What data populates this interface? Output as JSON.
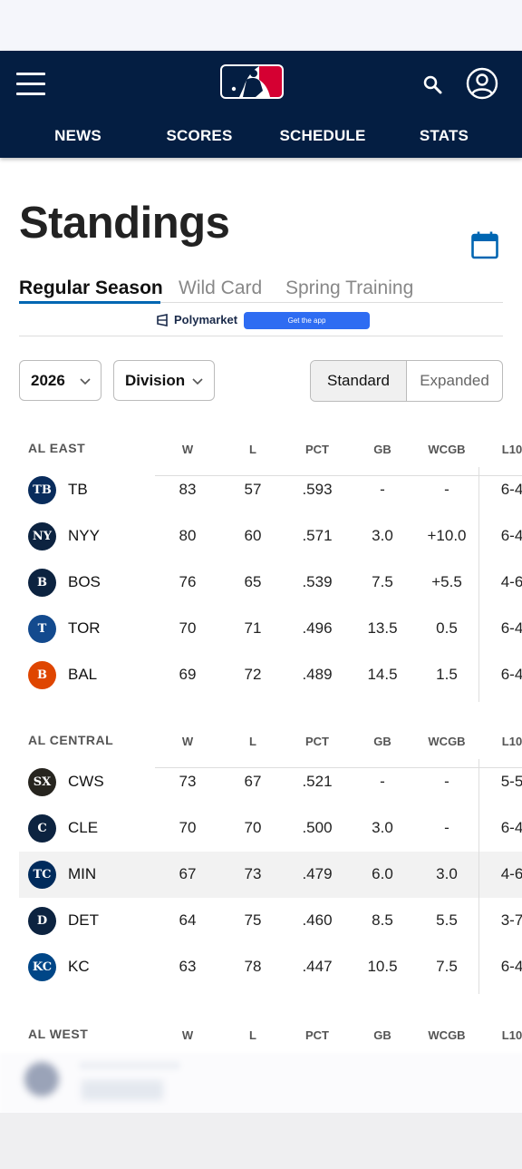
{
  "header": {
    "nav": [
      "NEWS",
      "SCORES",
      "SCHEDULE",
      "STATS"
    ]
  },
  "page": {
    "title": "Standings",
    "tabs": [
      "Regular Season",
      "Wild Card",
      "Spring Training"
    ],
    "active_tab": "Regular Season"
  },
  "ad": {
    "brand": "Polymarket",
    "button": "Get the app"
  },
  "filters": {
    "year": "2026",
    "grouping": "Division",
    "view_options": [
      "Standard",
      "Expanded"
    ],
    "selected_view": "Standard"
  },
  "columns": [
    "W",
    "L",
    "PCT",
    "GB",
    "WCGB",
    "L10"
  ],
  "divisions": [
    {
      "name": "AL EAST",
      "teams": [
        {
          "abbr": "TB",
          "logo": "TB",
          "color": "#092c5c",
          "w": "83",
          "l": "57",
          "pct": ".593",
          "gb": "-",
          "wcgb": "-",
          "l10": "6-4"
        },
        {
          "abbr": "NYY",
          "logo": "NY",
          "color": "#0c2340",
          "w": "80",
          "l": "60",
          "pct": ".571",
          "gb": "3.0",
          "wcgb": "+10.0",
          "l10": "6-4"
        },
        {
          "abbr": "BOS",
          "logo": "B",
          "color": "#0c2340",
          "w": "76",
          "l": "65",
          "pct": ".539",
          "gb": "7.5",
          "wcgb": "+5.5",
          "l10": "4-6"
        },
        {
          "abbr": "TOR",
          "logo": "T",
          "color": "#134a8e",
          "w": "70",
          "l": "71",
          "pct": ".496",
          "gb": "13.5",
          "wcgb": "0.5",
          "l10": "6-4"
        },
        {
          "abbr": "BAL",
          "logo": "B",
          "color": "#df4601",
          "w": "69",
          "l": "72",
          "pct": ".489",
          "gb": "14.5",
          "wcgb": "1.5",
          "l10": "6-4"
        }
      ]
    },
    {
      "name": "AL CENTRAL",
      "teams": [
        {
          "abbr": "CWS",
          "logo": "SX",
          "color": "#27251f",
          "w": "73",
          "l": "67",
          "pct": ".521",
          "gb": "-",
          "wcgb": "-",
          "l10": "5-5"
        },
        {
          "abbr": "CLE",
          "logo": "C",
          "color": "#0c2340",
          "w": "70",
          "l": "70",
          "pct": ".500",
          "gb": "3.0",
          "wcgb": "-",
          "l10": "6-4"
        },
        {
          "abbr": "MIN",
          "logo": "TC",
          "color": "#002b5c",
          "w": "67",
          "l": "73",
          "pct": ".479",
          "gb": "6.0",
          "wcgb": "3.0",
          "l10": "4-6"
        },
        {
          "abbr": "DET",
          "logo": "D",
          "color": "#0c2340",
          "w": "64",
          "l": "75",
          "pct": ".460",
          "gb": "8.5",
          "wcgb": "5.5",
          "l10": "3-7"
        },
        {
          "abbr": "KC",
          "logo": "KC",
          "color": "#004687",
          "w": "63",
          "l": "78",
          "pct": ".447",
          "gb": "10.5",
          "wcgb": "7.5",
          "l10": "6-4"
        }
      ]
    },
    {
      "name": "AL WEST",
      "teams": []
    }
  ]
}
